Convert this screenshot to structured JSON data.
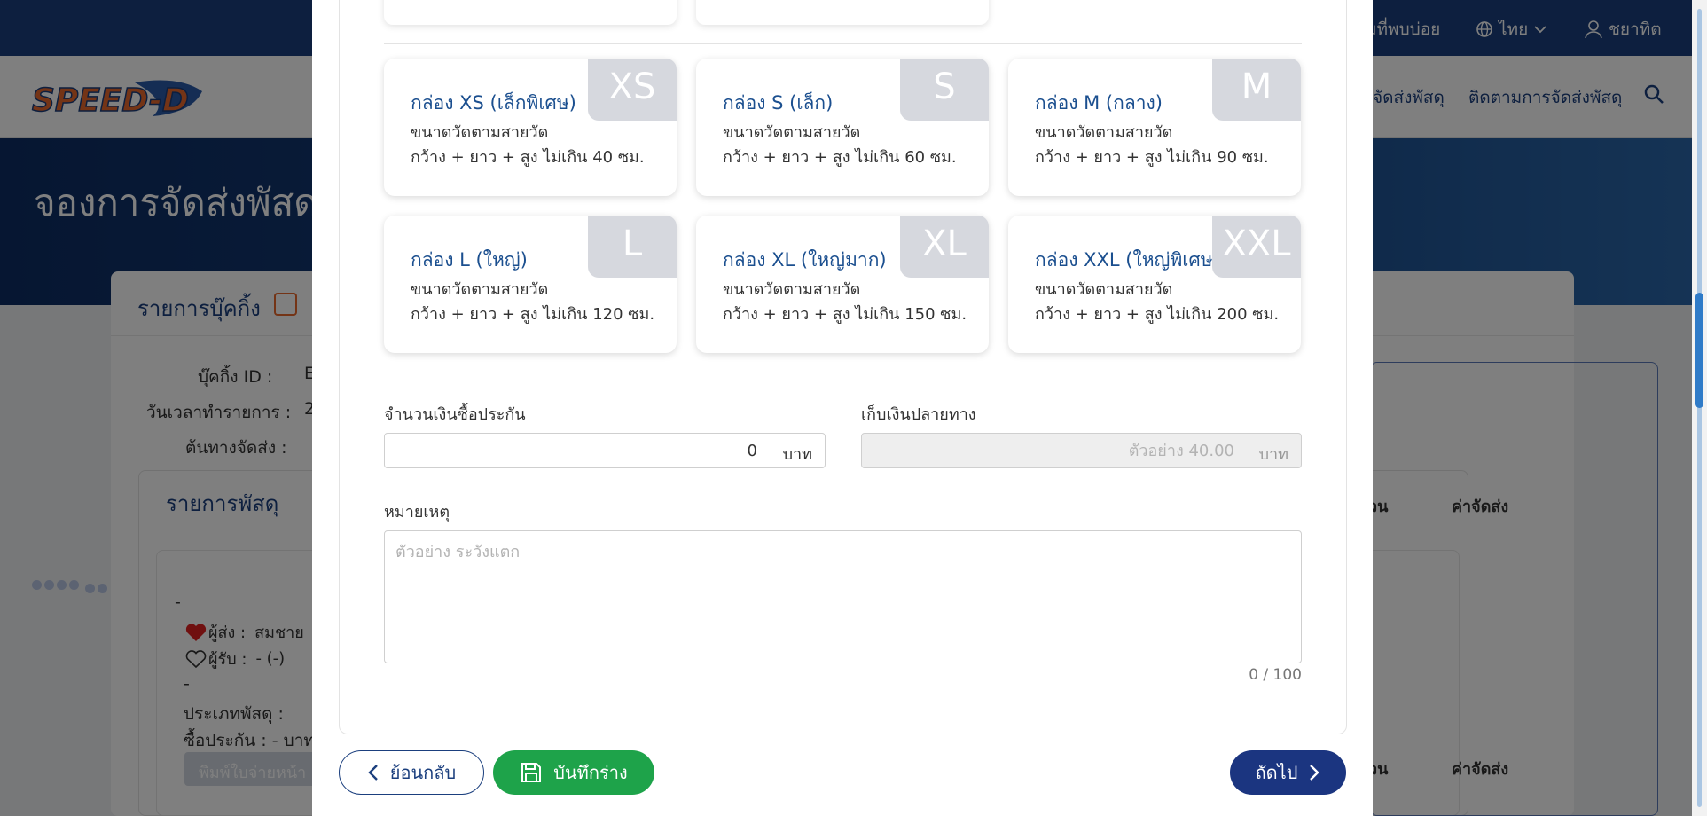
{
  "topbar": {
    "faq_partial": "มที่พบบ่อย",
    "language": "ไทย",
    "user": "ชยาทิต"
  },
  "navbar": {
    "logo_text": "SPEED-D",
    "link_booking_partial": "จัดส่งพัสดุ",
    "link_tracking": "ติดตามการจัดส่งพัสดุ"
  },
  "hero": {
    "title_partial": "จองการจัดส่งพัสด"
  },
  "booking_panel": {
    "title": "รายการบุ๊คกิ้ง",
    "booking_id_label": "บุ๊คกิ้ง ID :",
    "booking_id_value_partial": "E",
    "datetime_label": "วันเวลาทำรายการ :",
    "datetime_value_partial": "2",
    "origin_label": "ต้นทางจัดส่ง :",
    "parcels_title": "รายการพัสดุ",
    "parcel_dash": "-",
    "sender_label": "ผู้ส่ง :",
    "sender_value_partial": "สมชาย",
    "receiver_label": "ผู้รับ :",
    "receiver_value": "-  (-)",
    "parcel_dash2": "-",
    "parcel_type_label": "ประเภทพัสดุ :",
    "insurance_label": "ซื้อประกัน : - บาท",
    "print_button_partial": "พิมพ์ใบจ่ายหน้า",
    "col_qty_partial": "วน",
    "col_shipping": "ค่าจัดส่ง"
  },
  "modal": {
    "boxes": [
      {
        "code": "XS",
        "name": "กล่อง XS (เล็กพิเศษ)",
        "line1": "ขนาดวัดตามสายวัด",
        "line2": "กว้าง + ยาว + สูง ไม่เกิน 40 ซม."
      },
      {
        "code": "S",
        "name": "กล่อง S (เล็ก)",
        "line1": "ขนาดวัดตามสายวัด",
        "line2": "กว้าง + ยาว + สูง ไม่เกิน 60 ซม."
      },
      {
        "code": "M",
        "name": "กล่อง M (กลาง)",
        "line1": "ขนาดวัดตามสายวัด",
        "line2": "กว้าง + ยาว + สูง ไม่เกิน 90 ซม."
      },
      {
        "code": "L",
        "name": "กล่อง L (ใหญ่)",
        "line1": "ขนาดวัดตามสายวัด",
        "line2": "กว้าง + ยาว + สูง ไม่เกิน 120 ซม."
      },
      {
        "code": "XL",
        "name": "กล่อง XL (ใหญ่มาก)",
        "line1": "ขนาดวัดตามสายวัด",
        "line2": "กว้าง + ยาว + สูง ไม่เกิน 150 ซม."
      },
      {
        "code": "XXL",
        "name": "กล่อง XXL (ใหญ่พิเศษ",
        "line1": "ขนาดวัดตามสายวัด",
        "line2": "กว้าง + ยาว + สูง ไม่เกิน 200 ซม."
      }
    ],
    "insurance": {
      "label": "จำนวนเงินซื้อประกัน",
      "value": "0",
      "unit": "บาท"
    },
    "cod": {
      "label": "เก็บเงินปลายทาง",
      "placeholder": "ตัวอย่าง 40.00",
      "unit": "บาท"
    },
    "remark": {
      "label": "หมายเหตุ",
      "placeholder": "ตัวอย่าง ระวังแตก",
      "counter": "0 / 100"
    },
    "buttons": {
      "back": "ย้อนกลับ",
      "draft": "บันทึกร่าง",
      "next": "ถัดไป"
    }
  },
  "colors": {
    "primary": "#1b3f7e",
    "draft_green": "#1ea34a",
    "next_blue": "#1b3580",
    "badge_gray": "#d6d8de",
    "box_name_blue": "#1b4f8f",
    "heart_red": "#e02020"
  }
}
